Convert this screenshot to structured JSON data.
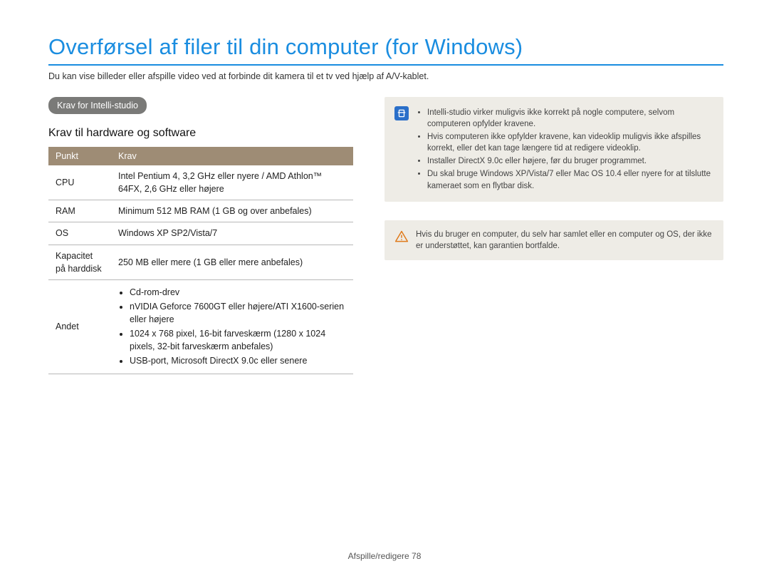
{
  "page_title": "Overførsel af filer til din computer (for Windows)",
  "subtitle": "Du kan vise billeder eller afspille video ved at forbinde dit kamera til et tv ved hjælp af A/V-kablet.",
  "section_chip": "Krav for Intelli-studio",
  "h2": "Krav til hardware og software",
  "table": {
    "headers": {
      "punkt": "Punkt",
      "krav": "Krav"
    },
    "rows": {
      "cpu": {
        "label": "CPU",
        "value": "Intel Pentium 4, 3,2 GHz eller nyere / AMD Athlon™ 64FX, 2,6 GHz eller højere"
      },
      "ram": {
        "label": "RAM",
        "value": "Minimum 512 MB RAM (1 GB og over anbefales)"
      },
      "os": {
        "label": "OS",
        "value": "Windows XP SP2/Vista/7"
      },
      "hdd": {
        "label": "Kapacitet på harddisk",
        "value": "250 MB eller mere (1 GB eller mere anbefales)"
      },
      "andet": {
        "label": "Andet",
        "items": {
          "0": "Cd-rom-drev",
          "1": "nVIDIA Geforce 7600GT eller højere/ATI X1600-serien eller højere",
          "2": "1024 x 768 pixel, 16-bit farveskærm (1280 x 1024 pixels, 32-bit farveskærm anbefales)",
          "3": "USB-port, Microsoft DirectX 9.0c eller senere"
        }
      }
    }
  },
  "notes": {
    "info": {
      "0": "Intelli-studio virker muligvis ikke korrekt på nogle computere, selvom computeren opfylder kravene.",
      "1": "Hvis computeren ikke opfylder kravene, kan videoklip muligvis ikke afspilles korrekt, eller det kan tage længere tid at redigere videoklip.",
      "2": "Installer DirectX 9.0c eller højere, før du bruger programmet.",
      "3": "Du skal bruge Windows XP/Vista/7 eller Mac OS 10.4 eller nyere for at tilslutte kameraet som en flytbar disk."
    },
    "warn": "Hvis du bruger en computer, du selv har samlet eller en computer og OS, der ikke er understøttet, kan garantien bortfalde."
  },
  "footer": {
    "section": "Afspille/redigere",
    "page": "78"
  }
}
